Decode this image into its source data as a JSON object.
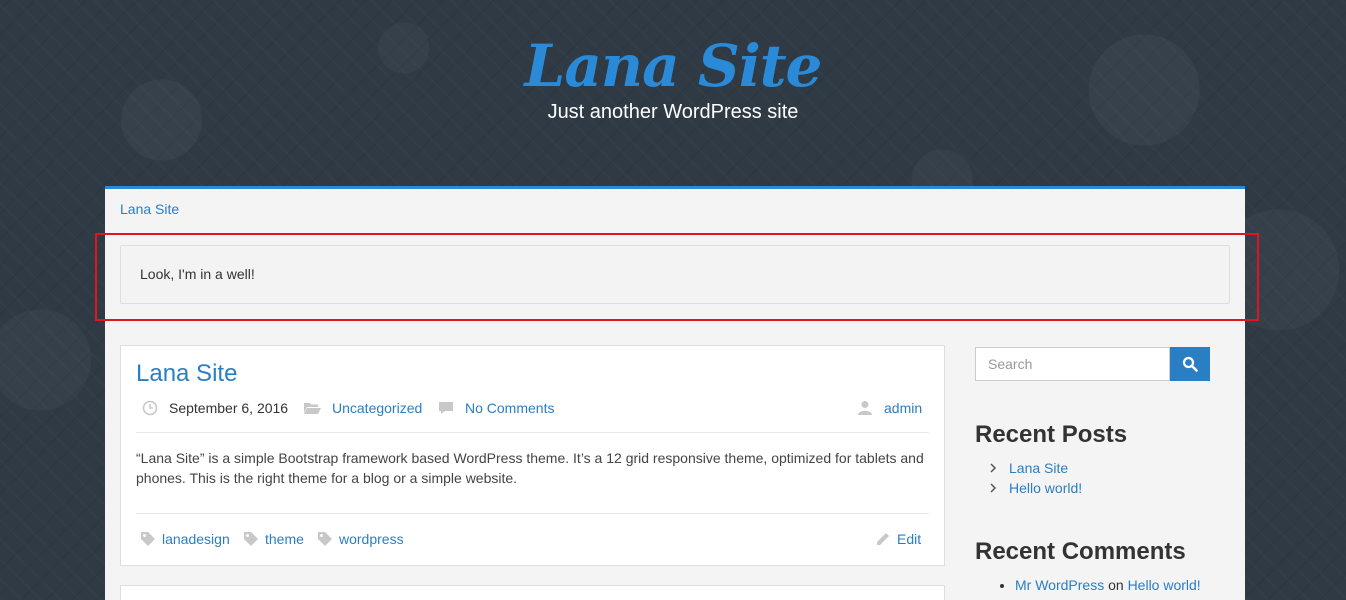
{
  "header": {
    "site_title": "Lana Site",
    "tagline": "Just another WordPress site"
  },
  "nav": {
    "brand": "Lana Site"
  },
  "well": {
    "text": "Look, I'm in a well!"
  },
  "post": {
    "title": "Lana Site",
    "date": "September 6, 2016",
    "category": "Uncategorized",
    "comments": "No Comments",
    "author": "admin",
    "excerpt": "“Lana Site” is a simple Bootstrap framework based WordPress theme. It’s a 12 grid responsive theme, optimized for tablets and phones. This is the right theme for a blog or a simple website.",
    "tags": [
      "lanadesign",
      "theme",
      "wordpress"
    ],
    "edit_label": "Edit"
  },
  "sidebar": {
    "search_placeholder": "Search",
    "recent_posts_title": "Recent Posts",
    "recent_posts": [
      "Lana Site",
      "Hello world!"
    ],
    "recent_comments_title": "Recent Comments",
    "recent_comment": {
      "author": "Mr WordPress",
      "on": "on",
      "post": "Hello world!"
    }
  },
  "colors": {
    "accent": "#2a7ec4",
    "title_blue": "#2a8ad8",
    "highlight_red": "#e0161e",
    "background": "#2f3a45"
  }
}
